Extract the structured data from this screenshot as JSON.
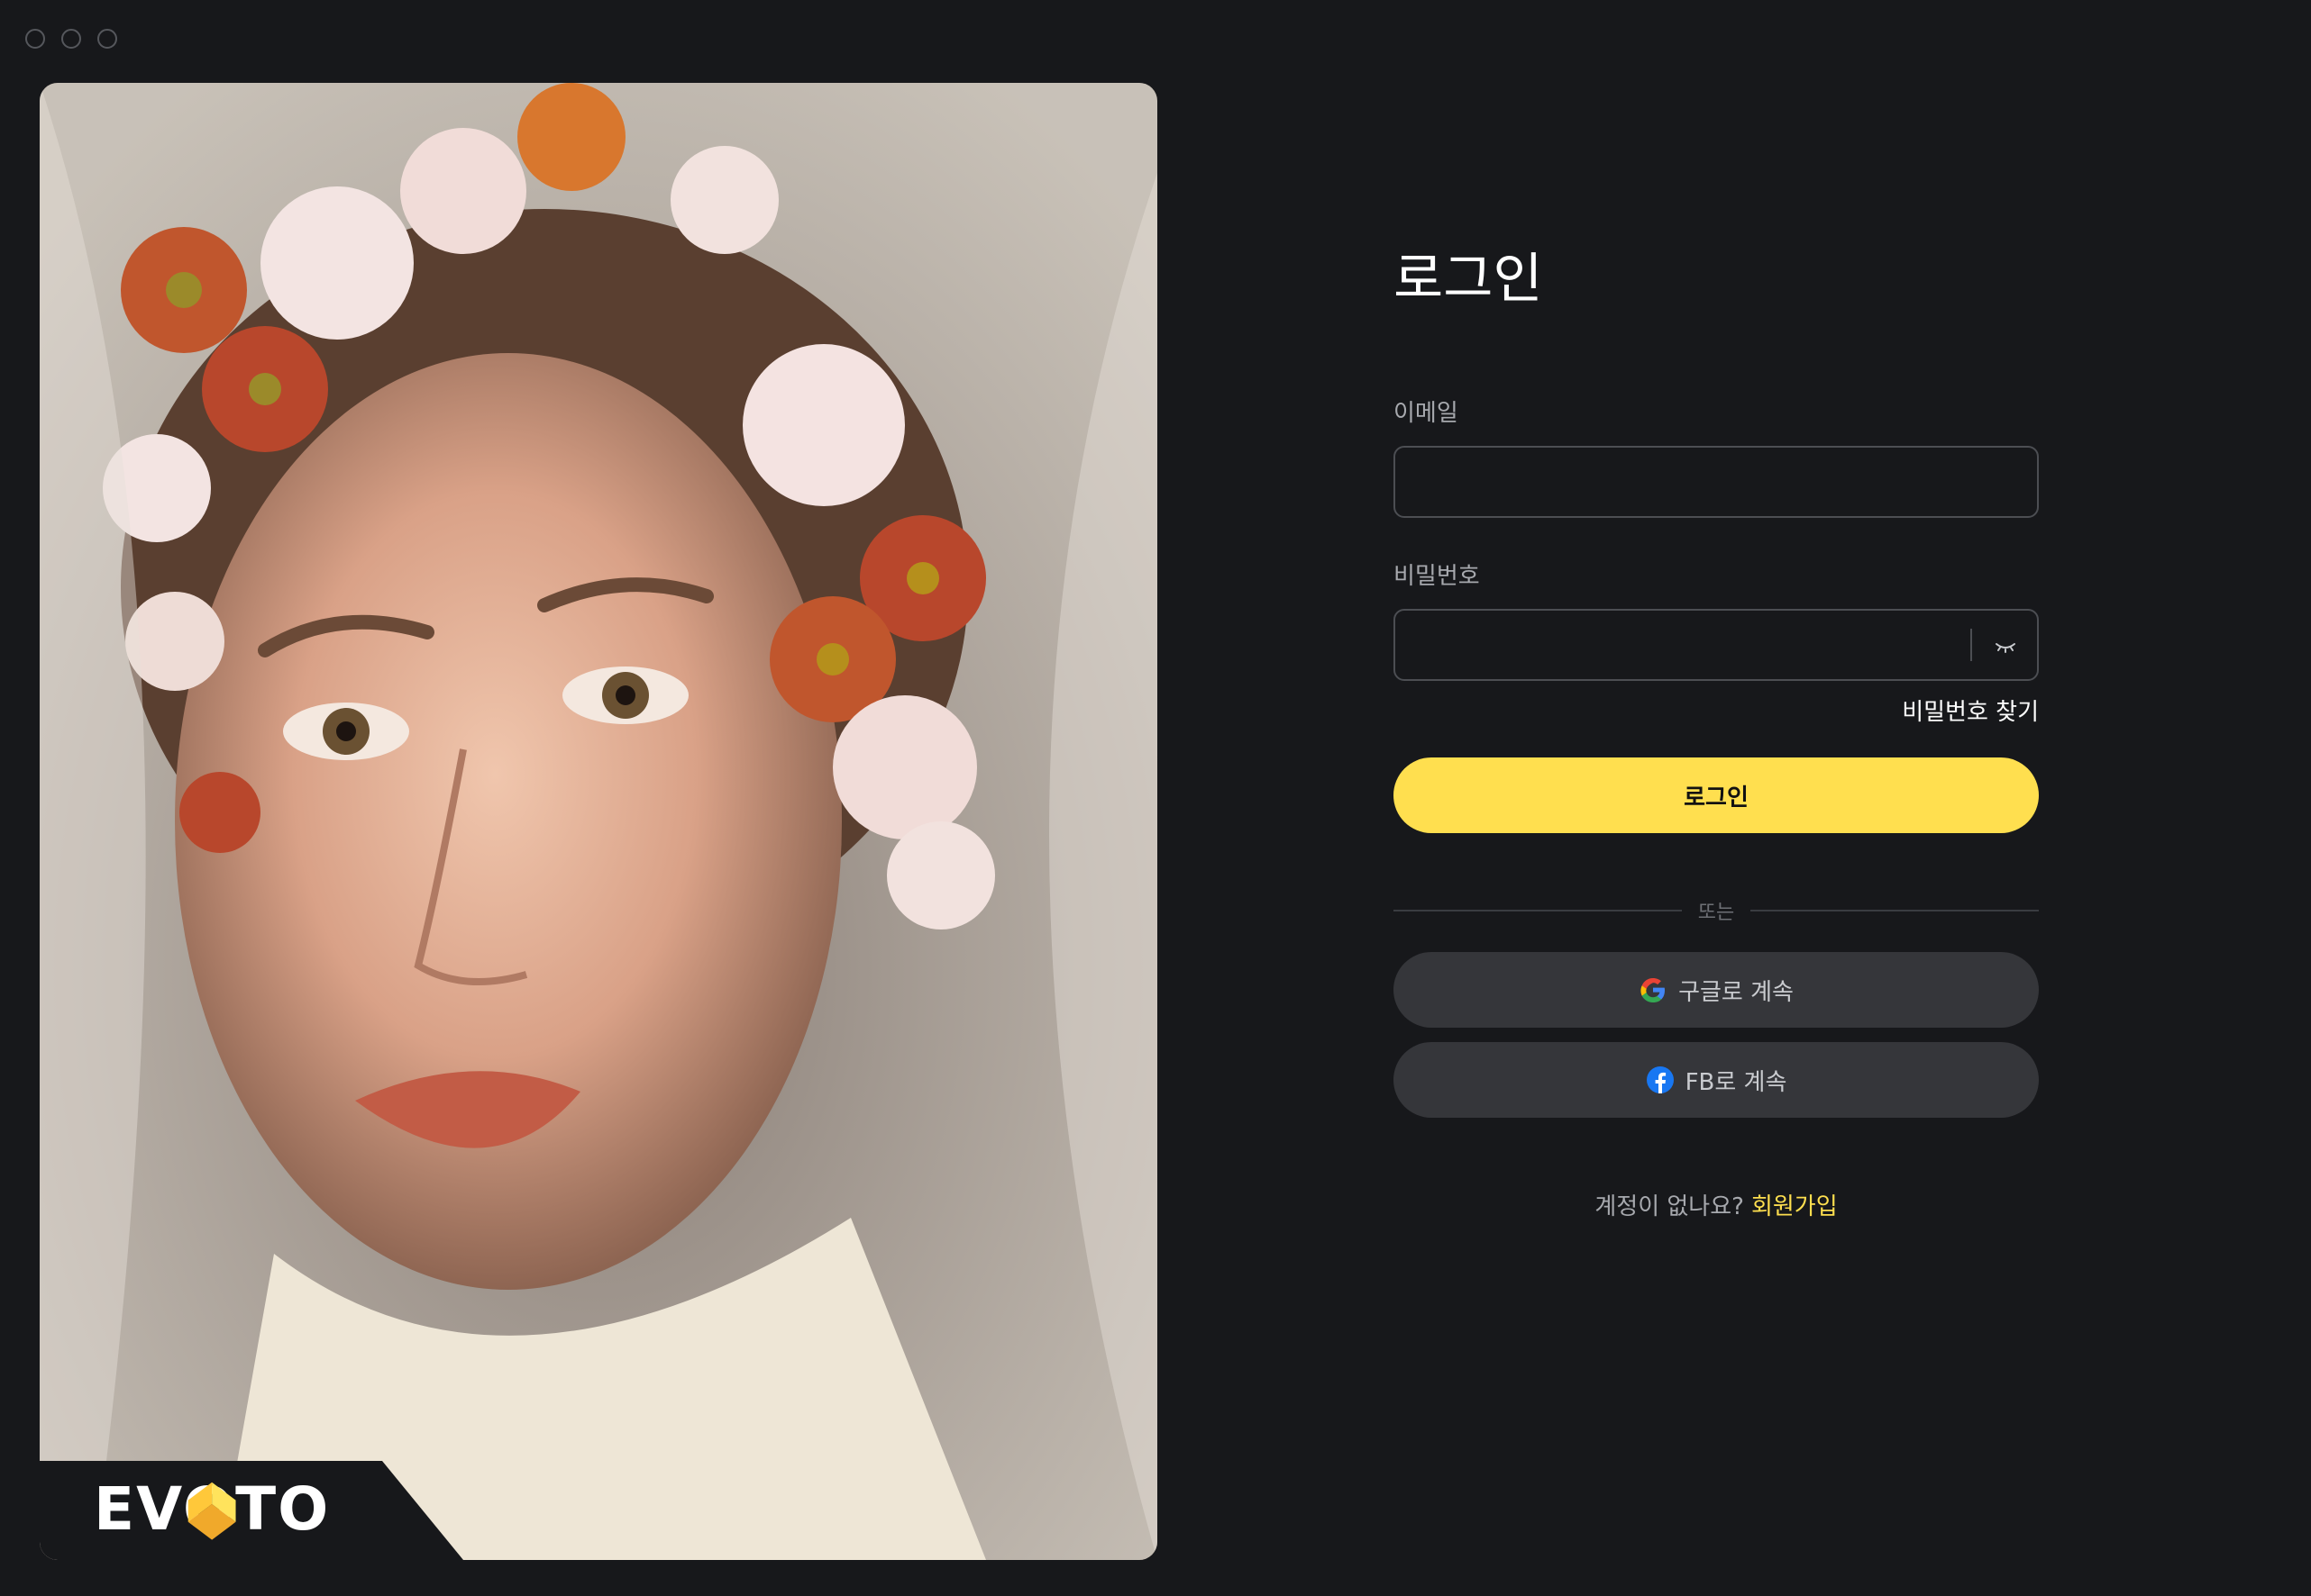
{
  "window": {
    "controls": [
      "close",
      "minimize",
      "zoom"
    ]
  },
  "brand": {
    "name": "EVOTO",
    "accent": "#ffdf4f"
  },
  "photo": {
    "subject_icon": "portrait-photo"
  },
  "login": {
    "title": "로그인",
    "email_label": "이메일",
    "email_placeholder": "",
    "password_label": "비밀번호",
    "password_placeholder": "",
    "forgot_label": "비밀번호 찾기",
    "submit_label": "로그인",
    "or_label": "또는",
    "google_label": "구글로 계속",
    "facebook_label": "FB로 계속",
    "no_account_label": "계정이 없나요?",
    "signup_label": "회원가입"
  }
}
